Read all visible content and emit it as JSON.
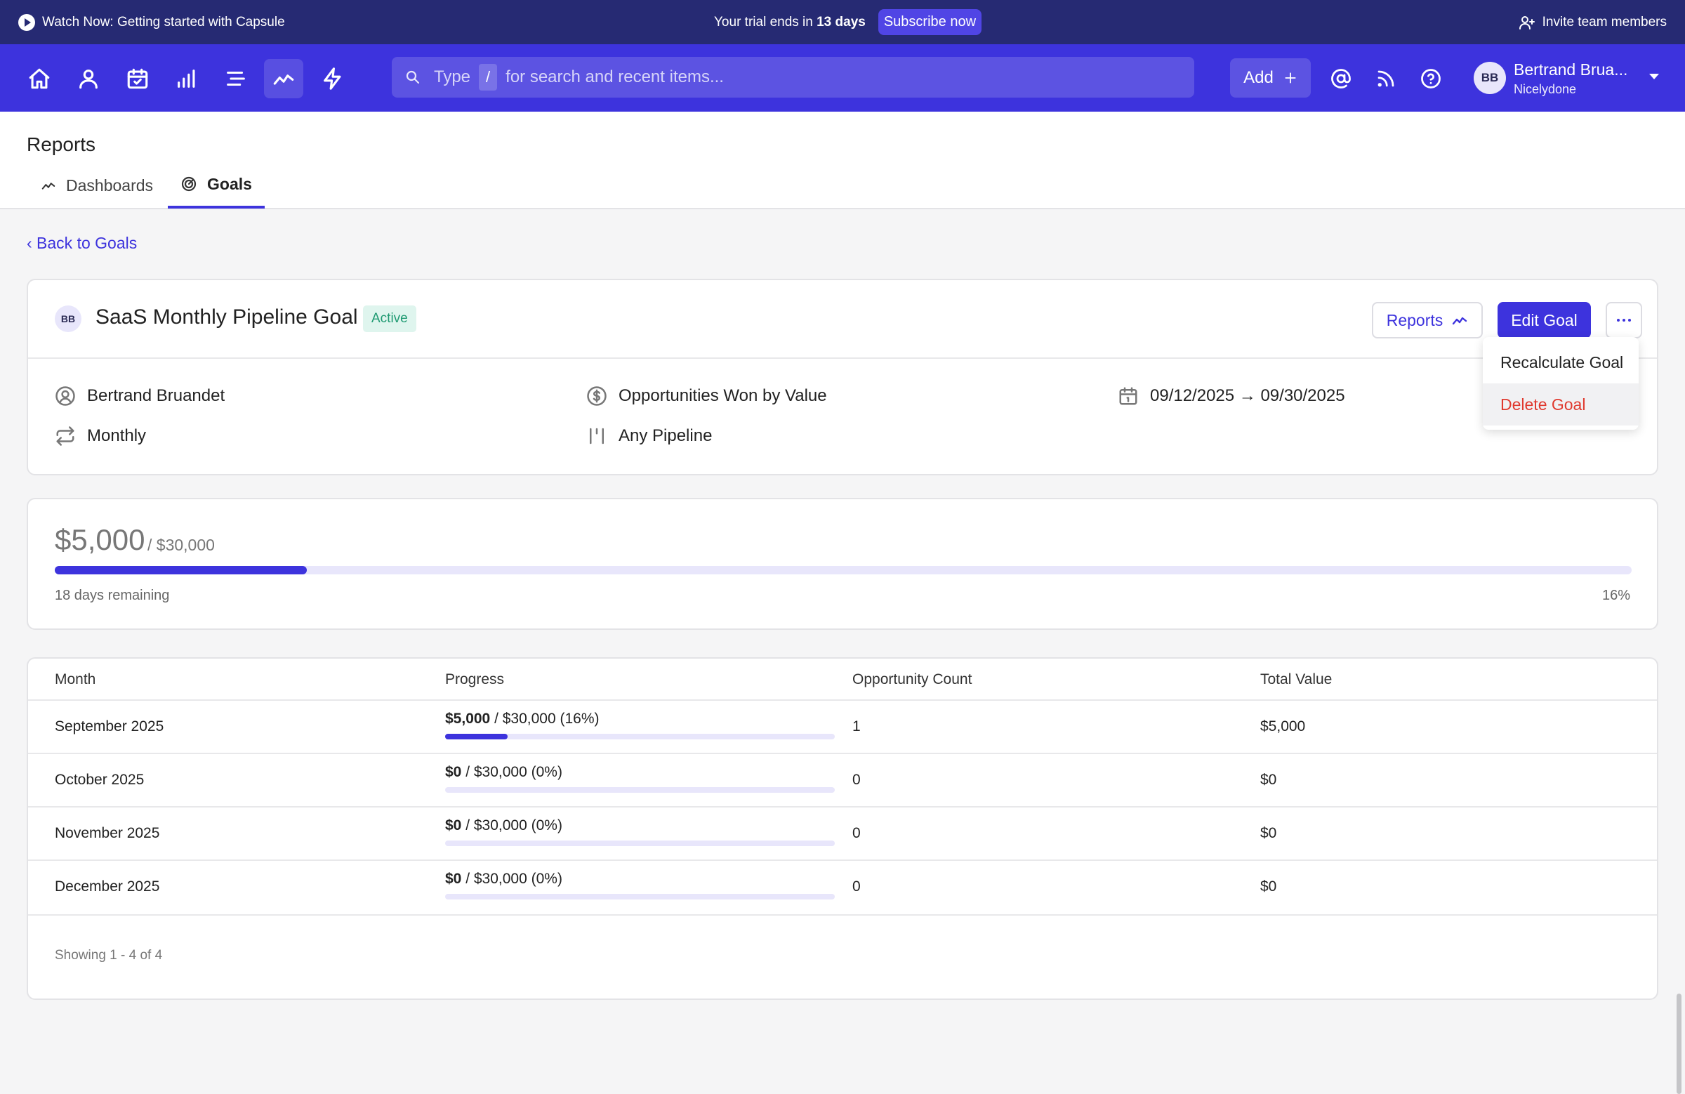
{
  "banner": {
    "watch_label": "Watch Now: Getting started with Capsule",
    "trial_prefix": "Your trial ends in ",
    "trial_days": "13 days",
    "subscribe_label": "Subscribe now",
    "invite_label": "Invite team members"
  },
  "nav": {
    "icons": [
      "home-icon",
      "person-icon",
      "calendar-check-icon",
      "bar-chart-icon",
      "list-icon",
      "trend-line-icon",
      "lightning-icon"
    ],
    "active_icon": "trend-line-icon",
    "search": {
      "prefix": "Type",
      "key": "/",
      "suffix": "for search and recent items..."
    },
    "add_label": "Add",
    "user": {
      "initials": "BB",
      "name": "Bertrand Brua...",
      "org": "Nicelydone"
    }
  },
  "page": {
    "title": "Reports",
    "tabs": [
      {
        "label": "Dashboards",
        "active": false
      },
      {
        "label": "Goals",
        "active": true
      }
    ],
    "back_label": "‹ Back to Goals"
  },
  "goal": {
    "avatar_initials": "BB",
    "name": "SaaS Monthly Pipeline Goal",
    "status": "Active",
    "reports_label": "Reports",
    "edit_label": "Edit Goal",
    "menu": {
      "recalculate_label": "Recalculate Goal",
      "delete_label": "Delete Goal"
    },
    "owner": "Bertrand Bruandet",
    "metric": "Opportunities Won by Value",
    "date_range": "09/12/2025 → 09/30/2025",
    "frequency": "Monthly",
    "pipeline": "Any Pipeline",
    "colors": {
      "accent": "#3d33dd",
      "banner": "#262a73",
      "active_badge": "#1f9a72",
      "delete": "#e0392e"
    }
  },
  "progress": {
    "amount": "$5,000",
    "target": "/ $30,000",
    "fraction": 0.16,
    "remaining": "18 days remaining",
    "percent_label": "16%"
  },
  "table": {
    "headers": {
      "month": "Month",
      "progress": "Progress",
      "count": "Opportunity Count",
      "value": "Total Value"
    },
    "rows": [
      {
        "month": "September 2025",
        "progress_amount": "$5,000",
        "progress_rest": " / $30,000 (16%)",
        "fraction": 0.16,
        "count": "1",
        "value": "$5,000"
      },
      {
        "month": "October 2025",
        "progress_amount": "$0",
        "progress_rest": " / $30,000 (0%)",
        "fraction": 0,
        "count": "0",
        "value": "$0"
      },
      {
        "month": "November 2025",
        "progress_amount": "$0",
        "progress_rest": " / $30,000 (0%)",
        "fraction": 0,
        "count": "0",
        "value": "$0"
      },
      {
        "month": "December 2025",
        "progress_amount": "$0",
        "progress_rest": " / $30,000 (0%)",
        "fraction": 0,
        "count": "0",
        "value": "$0"
      }
    ],
    "showing": "Showing 1 - 4 of 4"
  }
}
